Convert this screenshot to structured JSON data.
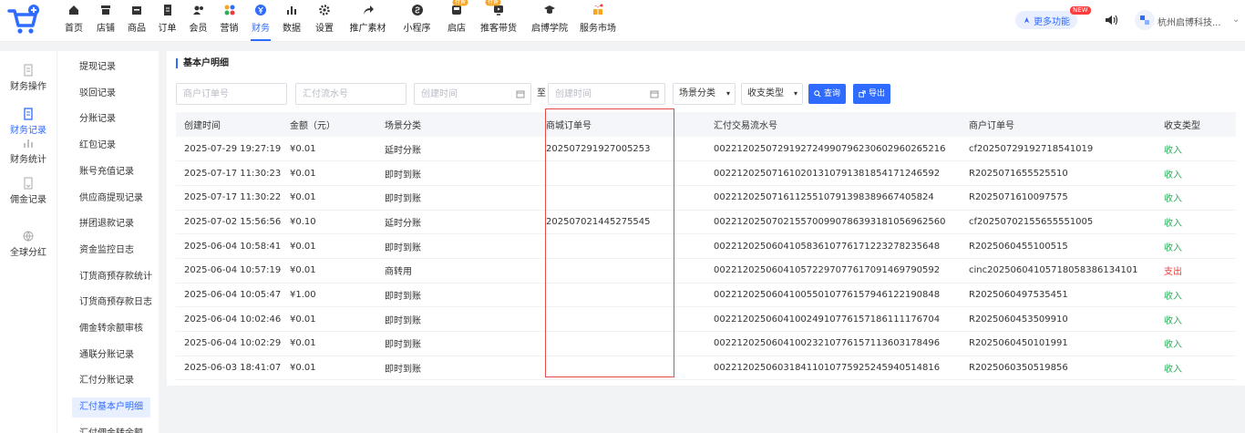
{
  "nav": {
    "items": [
      {
        "label": "首页",
        "icon": "home-icon",
        "left": 0,
        "width": 34
      },
      {
        "label": "店铺",
        "icon": "store-icon",
        "left": 0,
        "width": 36
      },
      {
        "label": "商品",
        "icon": "box-icon",
        "left": 0,
        "width": 32
      },
      {
        "label": "订单",
        "icon": "document-icon",
        "left": 0,
        "width": 35
      },
      {
        "label": "会员",
        "icon": "users-icon",
        "left": 0,
        "width": 33
      },
      {
        "label": "营销",
        "icon": "grid-icon",
        "left": 0,
        "width": 35
      },
      {
        "label": "财务",
        "icon": "yen-icon",
        "left": 0,
        "width": 34
      },
      {
        "label": "数据",
        "icon": "bar-chart-icon",
        "left": 0,
        "width": 34
      },
      {
        "label": "设置",
        "icon": "gear-icon",
        "left": 0,
        "width": 38
      },
      {
        "label": "推广素材",
        "icon": "share-icon",
        "left": 0,
        "width": 57
      },
      {
        "label": "小程序",
        "icon": "miniapp-icon",
        "left": 0,
        "width": 51
      },
      {
        "label": "启店",
        "icon": "shop-open-icon",
        "left": 0,
        "width": 36,
        "badge": "付费"
      },
      {
        "label": "推客带货",
        "icon": "live-icon",
        "left": 0,
        "width": 56,
        "badge": "付费"
      },
      {
        "label": "启博学院",
        "icon": "graduation-icon",
        "left": 0,
        "width": 56
      },
      {
        "label": "服务市场",
        "icon": "gift-icon",
        "left": 0,
        "width": 50
      }
    ],
    "active_index": 6
  },
  "header": {
    "more_label": "更多功能",
    "new_tag": "NEW",
    "shop_name": "杭州启博科技..."
  },
  "left_col": [
    {
      "label": "财务操作",
      "icon": "doc-icon",
      "active": false
    },
    {
      "label": "财务记录",
      "icon": "record-icon",
      "active": true
    },
    {
      "label": "财务统计",
      "icon": "stats-icon",
      "active": false
    },
    {
      "label": "佣金记录",
      "icon": "commission-icon",
      "active": false
    },
    {
      "label": "全球分红",
      "icon": "globe-icon",
      "active": false
    }
  ],
  "submenu": [
    "提现记录",
    "驳回记录",
    "分账记录",
    "红包记录",
    "账号充值记录",
    "供应商提现记录",
    "拼团退款记录",
    "资金监控日志",
    "订货商预存款统计",
    "订货商预存款日志",
    "佣金转余额审核",
    "通联分账记录",
    "汇付分账记录",
    "汇付基本户明细",
    "汇付佣金转余额"
  ],
  "submenu_active": 13,
  "page": {
    "section_title": "基本户明细",
    "filters": {
      "merchant_order_placeholder": "商户订单号",
      "huifu_serial_placeholder": "汇付流水号",
      "created_from_placeholder": "创建时间",
      "to_label": "至",
      "created_to_placeholder": "创建时间",
      "scene_select": "场景分类",
      "type_select": "收支类型",
      "query_label": "查询",
      "export_label": "导出"
    }
  },
  "table": {
    "headers": [
      "创建时间",
      "金额（元）",
      "场景分类",
      "商城订单号",
      "汇付交易流水号",
      "商户订单号",
      "收支类型"
    ],
    "rows": [
      [
        "2025-07-29 19:27:19",
        "¥0.01",
        "延时分账",
        "202507291927005253",
        "002212025072919272499079623060296026521 6",
        "cf20250729192718541019",
        "收入"
      ],
      [
        "2025-07-17 11:30:23",
        "¥0.01",
        "即时到账",
        "",
        "0022120250716102013107913818541712465 92",
        "R2025071655525510",
        "收入"
      ],
      [
        "2025-07-17 11:30:22",
        "¥0.01",
        "即时到账",
        "",
        "00221202507161125510791398389667405824",
        "R2025071610097575",
        "收入"
      ],
      [
        "2025-07-02 15:56:56",
        "¥0.10",
        "延时分账",
        "202507021445275545",
        "00221202507021557009907863931810569625 60",
        "cf20250702155655551005",
        "收入"
      ],
      [
        "2025-06-04 10:58:41",
        "¥0.01",
        "即时到账",
        "",
        "00221202506041058361077617122327823564 8",
        "R2025060455100515",
        "收入"
      ],
      [
        "2025-06-04 10:57:19",
        "¥0.01",
        "商转用",
        "",
        "0022120250604105722970776170914697905 92",
        "cinc20250604105718058386134101",
        "支出"
      ],
      [
        "2025-06-04 10:05:47",
        "¥1.00",
        "即时到账",
        "",
        "00221202506041005501077615794612219084 8",
        "R2025060497535451",
        "收入"
      ],
      [
        "2025-06-04 10:02:46",
        "¥0.01",
        "即时到账",
        "",
        "00221202506041002491077615718611117670 4",
        "R2025060453509910",
        "收入"
      ],
      [
        "2025-06-04 10:02:29",
        "¥0.01",
        "即时到账",
        "",
        "00221202506041002321077615711360317849 6",
        "R2025060450101991",
        "收入"
      ],
      [
        "2025-06-03 18:41:07",
        "¥0.01",
        "即时到账",
        "",
        "00221202506031841101077592524594051481 6",
        "R2025060350519856",
        "收入"
      ]
    ]
  },
  "colors": {
    "accent": "#2f6bff",
    "income": "#2db05b",
    "expense": "#ef3b3b",
    "highlight": "#e44a4a"
  }
}
